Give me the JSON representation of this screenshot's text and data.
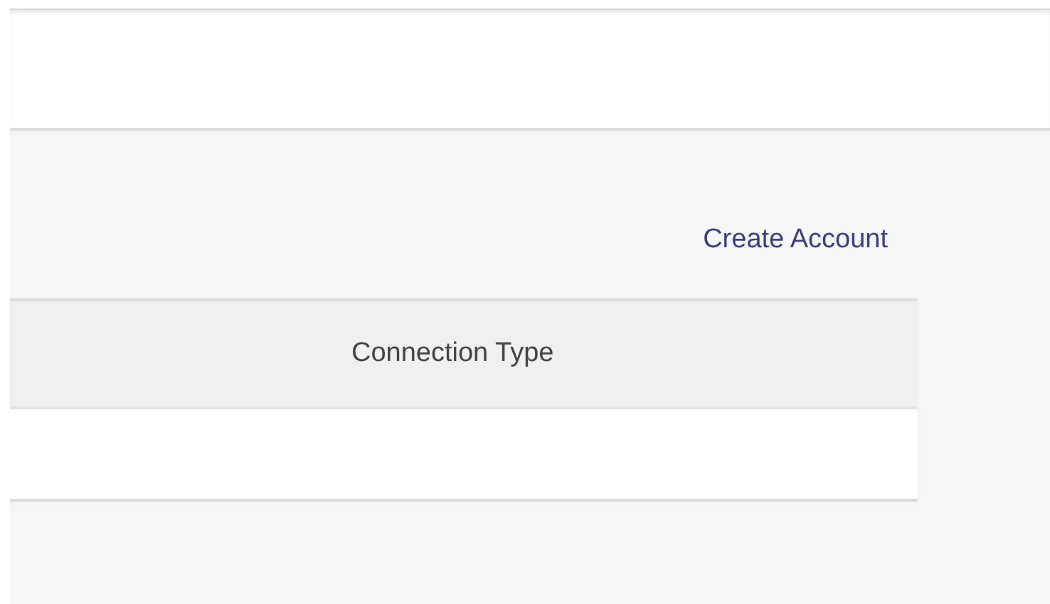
{
  "toolbar": {
    "link": "Create Account"
  },
  "table": {
    "columns": [
      "Connection Type"
    ]
  }
}
